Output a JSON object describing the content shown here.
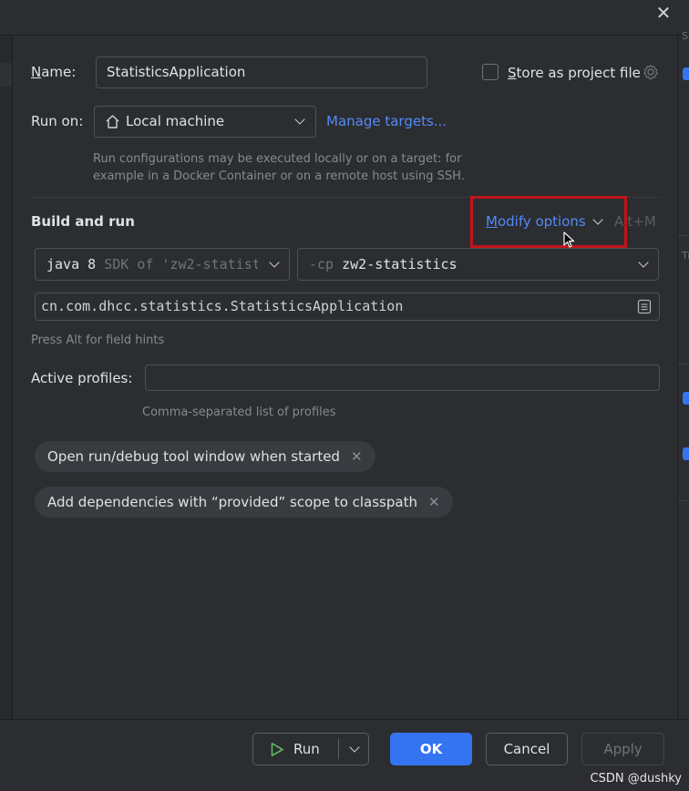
{
  "window": {
    "close_icon": "close-icon"
  },
  "name_field": {
    "label_underlined": "N",
    "label_rest": "ame:",
    "value": "StatisticsApplication"
  },
  "store_project": {
    "label_underlined": "S",
    "label_rest": "tore as project file",
    "checked": false,
    "icon": "gear-icon"
  },
  "run_on": {
    "label": "Run on:",
    "target": "Local machine",
    "target_icon": "house-icon",
    "manage_link": "Manage targets...",
    "hint_line1": "Run configurations may be executed locally or on a target: for",
    "hint_line2": "example in a Docker Container or on a remote host using SSH."
  },
  "build_run": {
    "heading": "Build and run",
    "modify_underlined": "M",
    "modify_rest": "odify options",
    "modify_shortcut": "Alt+M",
    "jdk_name": "java 8",
    "jdk_detail": "SDK of 'zw2-statist",
    "cp_prefix": "-cp",
    "cp_module": "zw2-statistics",
    "main_class": "cn.com.dhcc.statistics.StatisticsApplication",
    "field_hint": "Press Alt for field hints"
  },
  "profiles": {
    "label": "Active profiles:",
    "value": "",
    "hint": "Comma-separated list of profiles"
  },
  "chips": [
    {
      "label": "Open run/debug tool window when started"
    },
    {
      "label": "Add dependencies with “provided” scope to classpath"
    }
  ],
  "footer": {
    "run_label": "Run",
    "ok_label": "OK",
    "cancel_label": "Cancel",
    "apply_label": "Apply"
  },
  "right_strip": {
    "text_top": "Su",
    "text_mid": "Ti"
  },
  "watermark": "CSDN @dushky",
  "colors": {
    "accent": "#3574f0",
    "link": "#548af7",
    "highlight": "#c0141a",
    "background": "#2b2d30"
  }
}
